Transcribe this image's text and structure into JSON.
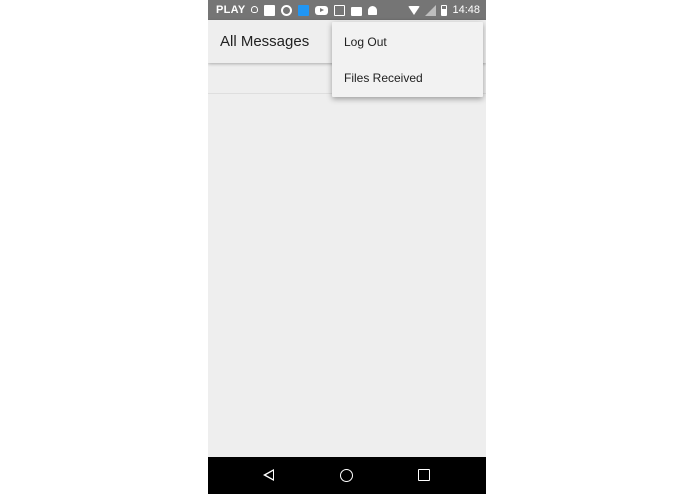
{
  "status_bar": {
    "carrier": "PLAY",
    "time": "14:48",
    "notification_icons": [
      "lightbulb-icon",
      "square-icon",
      "soccer-ball-icon",
      "mail-app-icon",
      "youtube-icon",
      "download-box-icon",
      "shopping-bag-icon",
      "android-icon"
    ],
    "system_icons": [
      "wifi-icon",
      "signal-icon",
      "battery-icon"
    ]
  },
  "app_bar": {
    "title": "All Messages"
  },
  "overflow_menu": {
    "items": [
      {
        "label": "Log Out"
      },
      {
        "label": "Files Received"
      }
    ]
  },
  "nav_bar": {
    "buttons": [
      "back-icon",
      "home-icon",
      "recents-icon"
    ]
  },
  "colors": {
    "status_bar": "#757575",
    "background": "#eeeeee",
    "menu": "#f2f2f2",
    "nav_bar": "#000000"
  }
}
